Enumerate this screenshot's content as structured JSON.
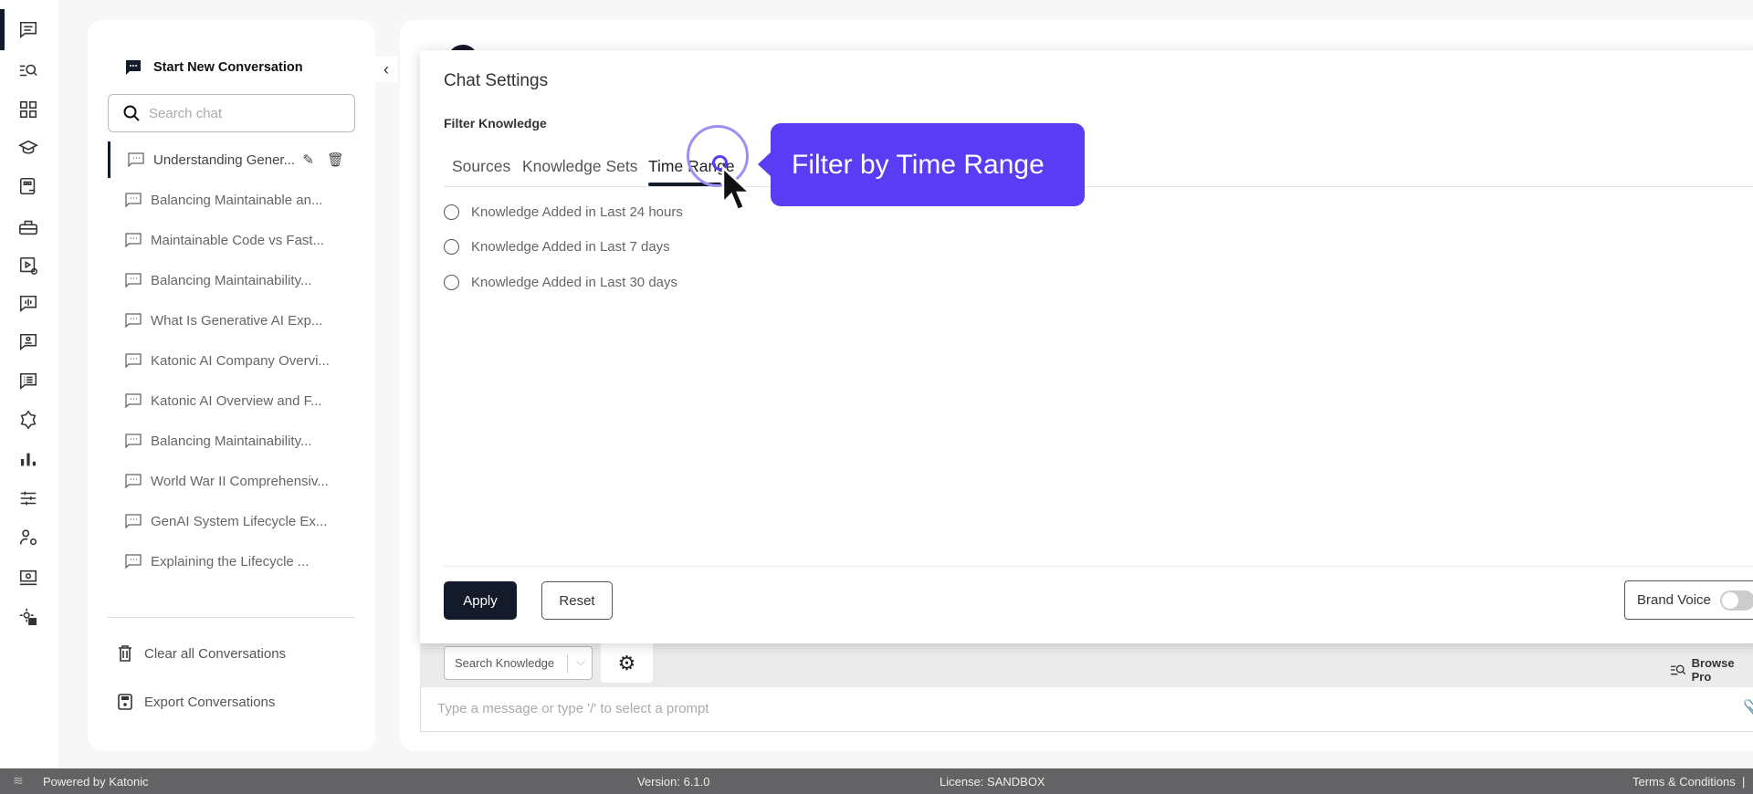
{
  "rail": {
    "items": [
      "chat-icon",
      "browse-prompts-icon",
      "dashboard-icon",
      "learning-icon",
      "knowledge-link-icon",
      "toolbox-icon",
      "video-settings-icon",
      "voice-chat-icon",
      "contact-chat-icon",
      "list-chat-icon",
      "extensions-icon",
      "analytics-icon",
      "sliders-icon",
      "user-settings-icon",
      "monitor-search-icon",
      "admin-settings-icon"
    ]
  },
  "sidebar": {
    "new_conversation": "Start New Conversation",
    "search_placeholder": "Search chat",
    "conversations": [
      "Understanding Gener...",
      "Balancing Maintainable an...",
      "Maintainable Code vs Fast...",
      "Balancing Maintainability...",
      "What Is Generative AI Exp...",
      "Katonic AI Company Overvi...",
      "Katonic AI Overview and F...",
      "Balancing Maintainability...",
      "World War II Comprehensiv...",
      "GenAI System Lifecycle Ex...",
      "Explaining the Lifecycle ..."
    ],
    "clear_all": "Clear all Conversations",
    "export": "Export Conversations"
  },
  "modal": {
    "title": "Chat Settings",
    "section": "Filter Knowledge",
    "tabs": [
      "Sources",
      "Knowledge Sets",
      "Time Range"
    ],
    "active_tab": "Time Range",
    "options": [
      "Knowledge Added in Last 24 hours",
      "Knowledge Added in Last 7 days",
      "Knowledge Added in Last 30 days"
    ],
    "apply": "Apply",
    "reset": "Reset",
    "brand_voice": "Brand Voice",
    "brand_voice_on": false
  },
  "composer": {
    "search_knowledge": "Search Knowledge",
    "browse_prompts": "Browse Pro",
    "placeholder": "Type a message or type '/' to select a prompt"
  },
  "tooltip": {
    "text": "Filter by Time Range",
    "color": "#5b3cf5"
  },
  "footer": {
    "powered": "Powered by Katonic",
    "version": "Version: 6.1.0",
    "license": "License: SANDBOX",
    "terms": "Terms & Conditions",
    "sep": "|"
  }
}
